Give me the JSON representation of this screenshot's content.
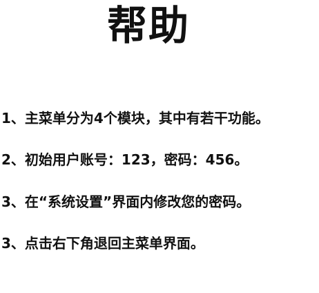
{
  "title": "帮助",
  "items": [
    "1、主菜单分为4个模块，其中有若干功能。",
    "2、初始用户账号：123，密码：456。",
    "3、在“系统设置”界面内修改您的密码。",
    "3、点击右下角退回主菜单界面。"
  ]
}
